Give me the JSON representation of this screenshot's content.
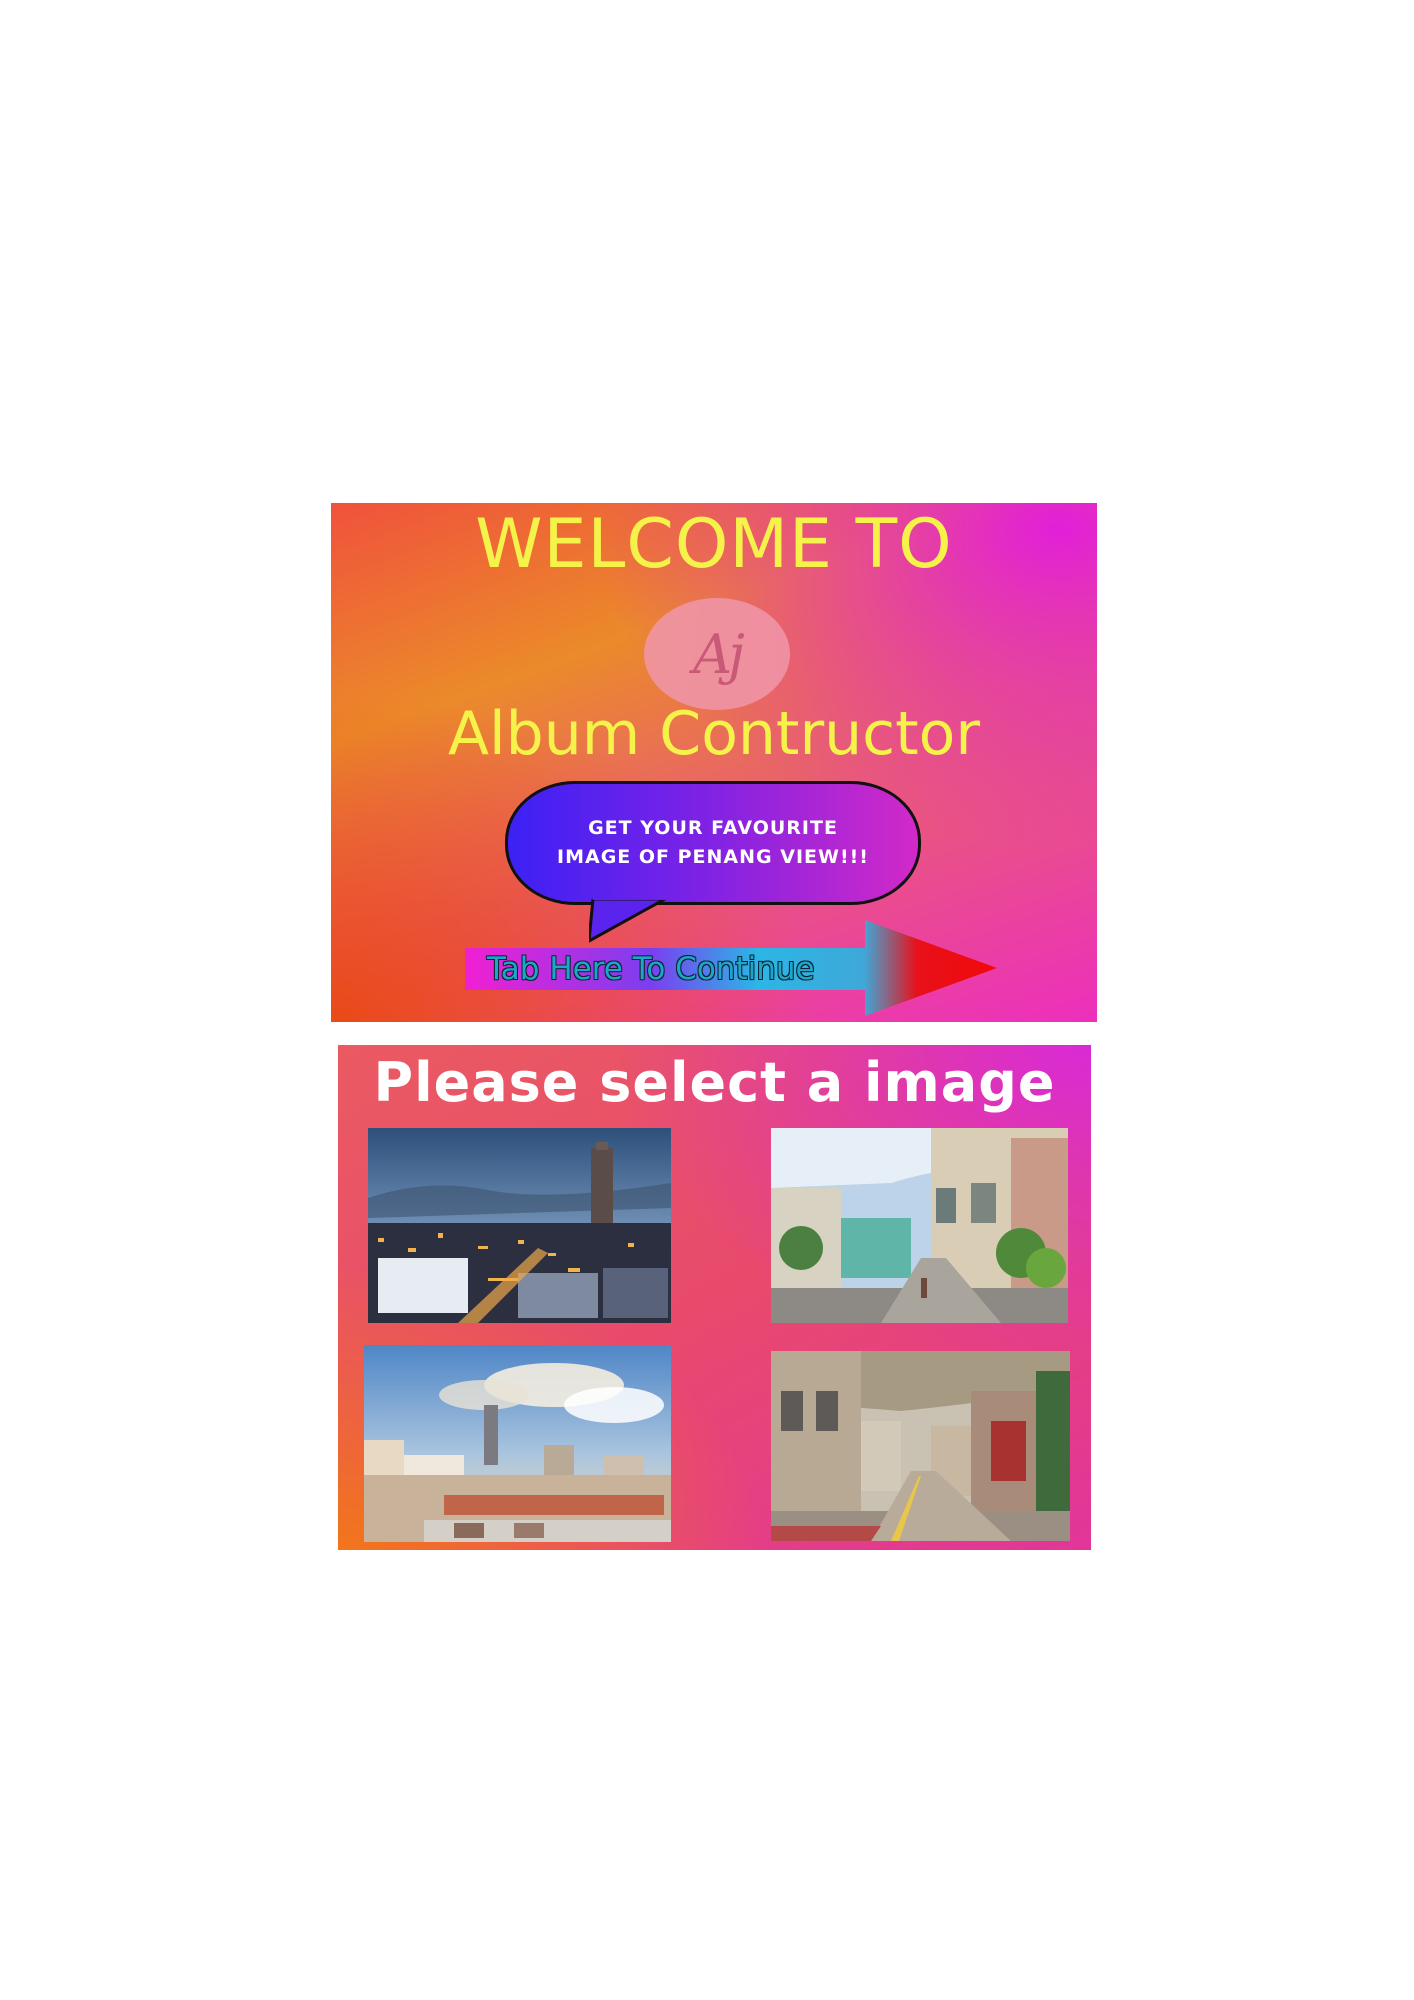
{
  "welcome": {
    "title": "WELCOME TO",
    "logo_text": "Aj",
    "app_name": "Album Contructor",
    "bubble": {
      "line1": "GET YOUR FAVOURITE",
      "line2": "IMAGE OF PENANG VIEW!!!"
    },
    "continue_label": "Tab Here To Continue"
  },
  "select": {
    "title": "Please select a image",
    "images": [
      {
        "icon": "city-night-skyline-image"
      },
      {
        "icon": "heritage-street-image"
      },
      {
        "icon": "city-daytime-skyline-image"
      },
      {
        "icon": "old-town-street-image"
      }
    ]
  },
  "colors": {
    "title_yellow": "#f5f34a",
    "bubble_blue": "#3c21f5",
    "bubble_magenta": "#d229c8",
    "arrow_red": "#e8101a"
  }
}
